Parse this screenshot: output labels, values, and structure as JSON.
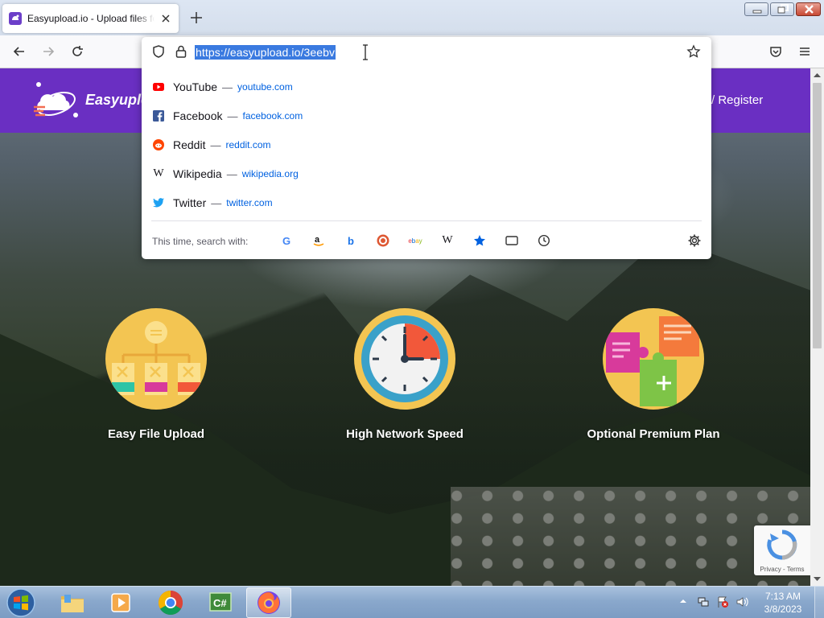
{
  "browser": {
    "tab": {
      "title": "Easyupload.io - Upload files for",
      "favicon": "easyupload-favicon"
    },
    "window_controls": [
      "minimize",
      "maximize",
      "close"
    ],
    "urlbar": {
      "url": "https://easyupload.io/3eebv",
      "selected": true
    }
  },
  "suggestions": [
    {
      "name": "YouTube",
      "url": "youtube.com",
      "icon": "youtube-icon",
      "color": "#ff0000"
    },
    {
      "name": "Facebook",
      "url": "facebook.com",
      "icon": "facebook-icon",
      "color": "#1877f2"
    },
    {
      "name": "Reddit",
      "url": "reddit.com",
      "icon": "reddit-icon",
      "color": "#ff4500"
    },
    {
      "name": "Wikipedia",
      "url": "wikipedia.org",
      "icon": "wikipedia-icon",
      "color": "#000000"
    },
    {
      "name": "Twitter",
      "url": "twitter.com",
      "icon": "twitter-icon",
      "color": "#1da1f2"
    }
  ],
  "separator": "—",
  "search_with": {
    "label": "This time, search with:",
    "engines": [
      "google",
      "amazon",
      "bing",
      "duckduckgo",
      "ebay",
      "wikipedia",
      "bookmarks",
      "tabs",
      "history"
    ]
  },
  "site": {
    "brand": "Easyupload",
    "header_link": "/ Register",
    "accent": "#6a2fc2",
    "features": [
      {
        "label": "Easy File Upload",
        "icon": "sitemap-icon"
      },
      {
        "label": "High Network Speed",
        "icon": "clock-icon"
      },
      {
        "label": "Optional Premium Plan",
        "icon": "puzzle-icon"
      }
    ],
    "recaptcha": {
      "links": "Privacy - Terms"
    }
  },
  "taskbar": {
    "apps": [
      "file-explorer",
      "media-player",
      "chrome",
      "csharp-ide",
      "firefox"
    ],
    "active": "firefox",
    "clock": {
      "time": "7:13 AM",
      "date": "3/8/2023"
    }
  }
}
